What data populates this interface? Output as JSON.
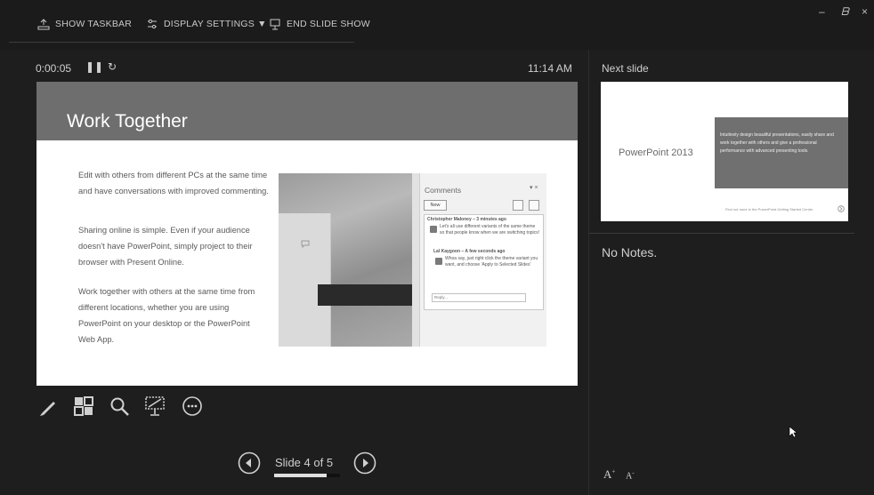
{
  "toolbar": {
    "show_taskbar": "SHOW TASKBAR",
    "display_settings": "DISPLAY SETTINGS ▼",
    "end_slide_show": "END SLIDE SHOW"
  },
  "window_controls": {
    "minimize": "–",
    "restore": "🗗",
    "close": "×"
  },
  "presenter": {
    "timer": "0:00:05",
    "clock": "11:14 AM"
  },
  "current_slide": {
    "title": "Work Together",
    "paragraphs": [
      "Edit with others from different PCs at the same time and have conversations with improved commenting.",
      "Sharing online is simple. Even if your audience doesn't have PowerPoint, simply project to their browser with Present Online.",
      "Work together with others at the same time from different locations, whether you are using PowerPoint on your desktop or the PowerPoint Web App."
    ],
    "comments_panel": {
      "title": "Comments",
      "new_button": "New",
      "comment1_author": "Christopher Maloney – 3 minutes ago",
      "comment1_text": "Let's all use different variants of the same theme so that people know when we are switching topics!",
      "comment2_author": "Lal Kaygoon – A few seconds ago",
      "comment2_text": "Whoa say, just right click the theme variant you want, and choose 'Apply to Selected Slides'",
      "reply_placeholder": "Reply..."
    }
  },
  "navigation": {
    "slide_counter": "Slide 4 of 5",
    "current": 4,
    "total": 5
  },
  "next_slide": {
    "label": "Next slide",
    "title": "PowerPoint 2013",
    "box_text": "Intuitively design beautiful presentations, easily share and work together with others and give a professional performance with advanced presenting tools.",
    "footer": "Find out more in the PowerPoint Getting Started Center"
  },
  "notes": {
    "text": "No Notes."
  },
  "font_controls": {
    "increase": "A",
    "decrease": "A"
  },
  "icons": {
    "pen": "pen-icon",
    "grid": "see-all-slides-icon",
    "zoom": "magnifier-icon",
    "black_screen": "black-screen-icon",
    "more": "more-options-icon",
    "prev": "previous-arrow-icon",
    "next": "next-arrow-icon"
  },
  "colors": {
    "background": "#1e1e1e",
    "slide_header": "#6e6e6e",
    "text": "#cfcfcf"
  }
}
